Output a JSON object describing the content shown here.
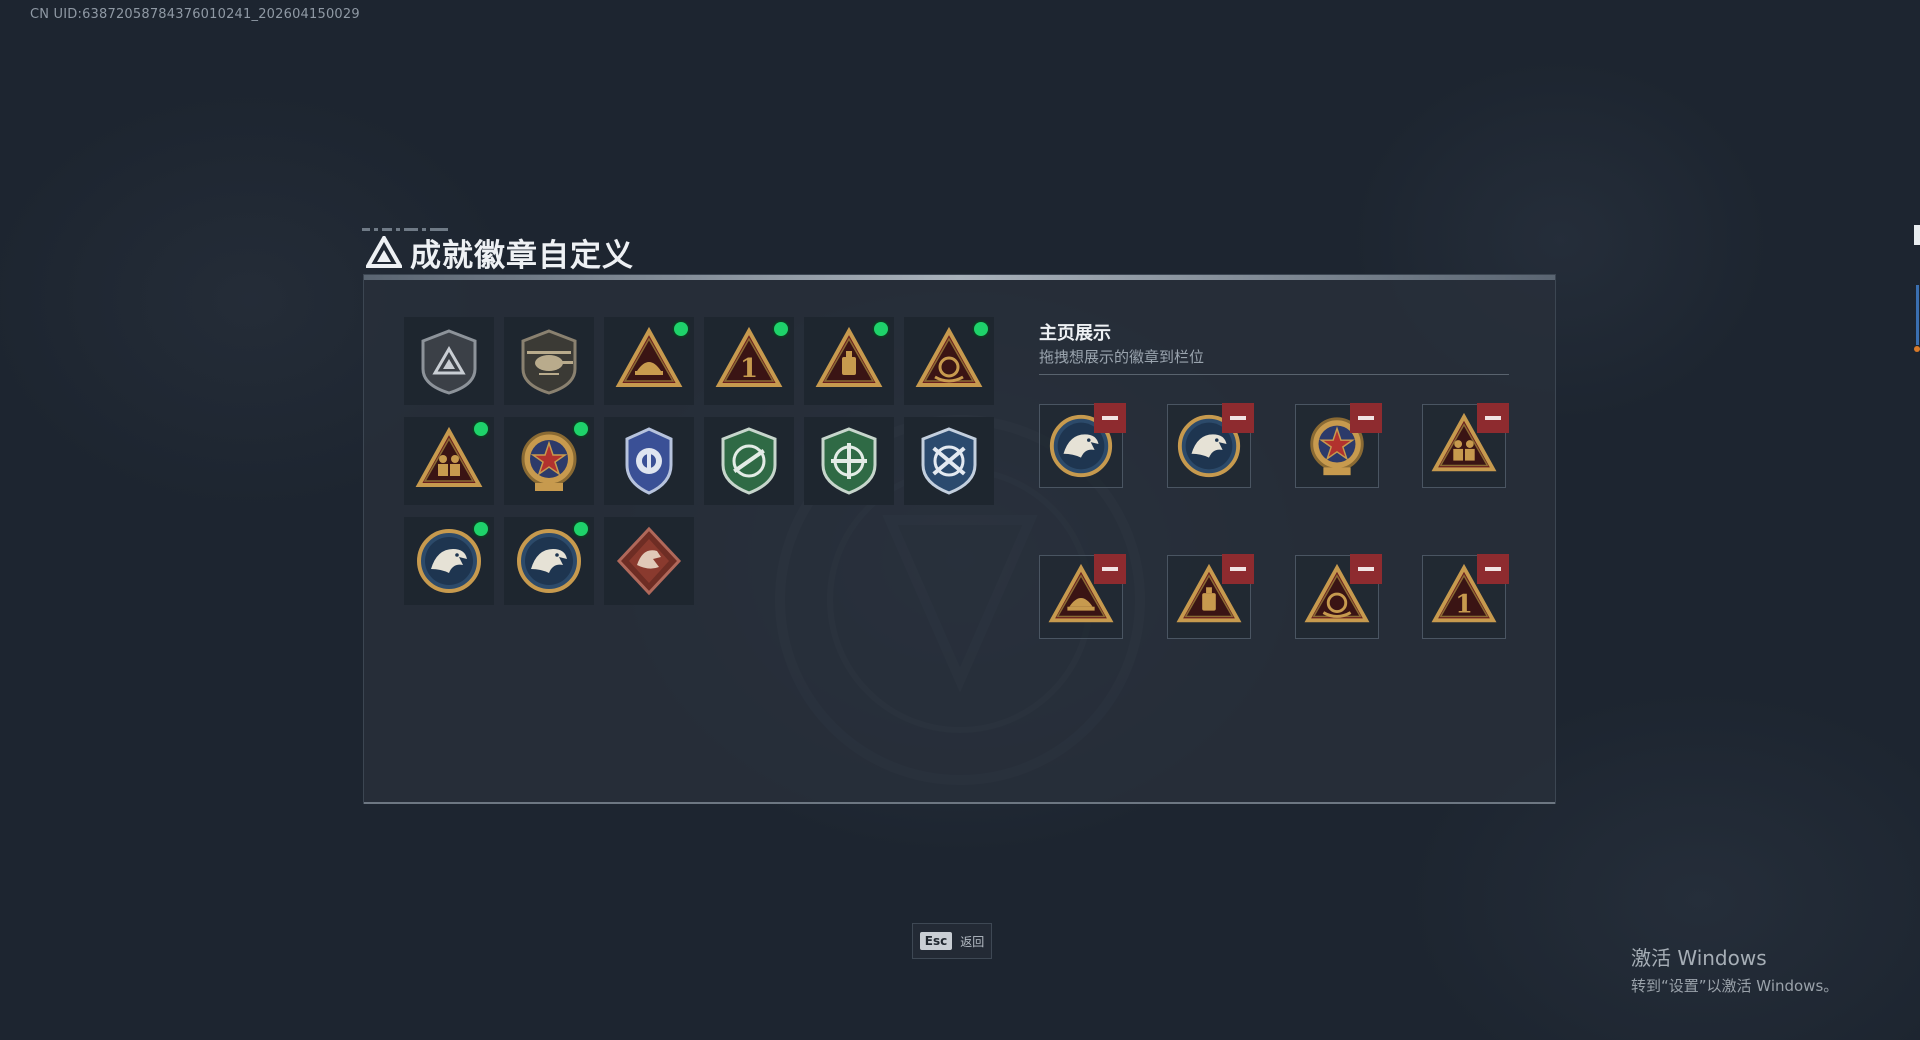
{
  "uid_text": "CN UID:6387205878437601024​1_202604150029",
  "title": "成就徽章自定义",
  "showcase": {
    "title": "主页展示",
    "subtitle": "拖拽想展示的徽章到栏位"
  },
  "badges": [
    {
      "icon": "gray-shield-triangle-icon",
      "new": false
    },
    {
      "icon": "helicopter-shield-icon",
      "new": false
    },
    {
      "icon": "gold-triangle-helmet-icon",
      "new": true
    },
    {
      "icon": "gold-triangle-number-one-icon",
      "new": true
    },
    {
      "icon": "gold-triangle-device-icon",
      "new": true
    },
    {
      "icon": "gold-triangle-wreath-icon",
      "new": true
    },
    {
      "icon": "gold-triangle-soldiers-icon",
      "new": true
    },
    {
      "icon": "star-medal-icon",
      "new": true
    },
    {
      "icon": "blue-police-badge-icon",
      "new": false
    },
    {
      "icon": "green-shield-rifle-icon",
      "new": false
    },
    {
      "icon": "green-shield-crosshair-icon",
      "new": false
    },
    {
      "icon": "blue-shield-crossed-rifles-icon",
      "new": false
    },
    {
      "icon": "eagle-round-badge-icon",
      "new": true
    },
    {
      "icon": "eagle-round-badge-icon",
      "new": true
    },
    {
      "icon": "dragon-diamond-badge-icon",
      "new": false
    }
  ],
  "showcase_slots": [
    {
      "icon": "eagle-round-badge-icon"
    },
    {
      "icon": "eagle-round-badge-icon"
    },
    {
      "icon": "star-medal-icon"
    },
    {
      "icon": "gold-triangle-soldiers-icon"
    },
    {
      "icon": "gold-triangle-helmet-icon"
    },
    {
      "icon": "gold-triangle-device-icon"
    },
    {
      "icon": "gold-triangle-wreath-icon"
    },
    {
      "icon": "gold-triangle-number-one-icon"
    }
  ],
  "esc": {
    "key": "Esc",
    "label": "返回"
  },
  "windows_watermark": {
    "line1": "激活 Windows",
    "line2": "转到“设置”以激活 Windows。"
  },
  "colors": {
    "background": "#1d2530",
    "panel": "#28303a",
    "new_indicator": "#1ed36a",
    "remove_button": "#8e2b2f",
    "gold": "#c79a4e"
  }
}
